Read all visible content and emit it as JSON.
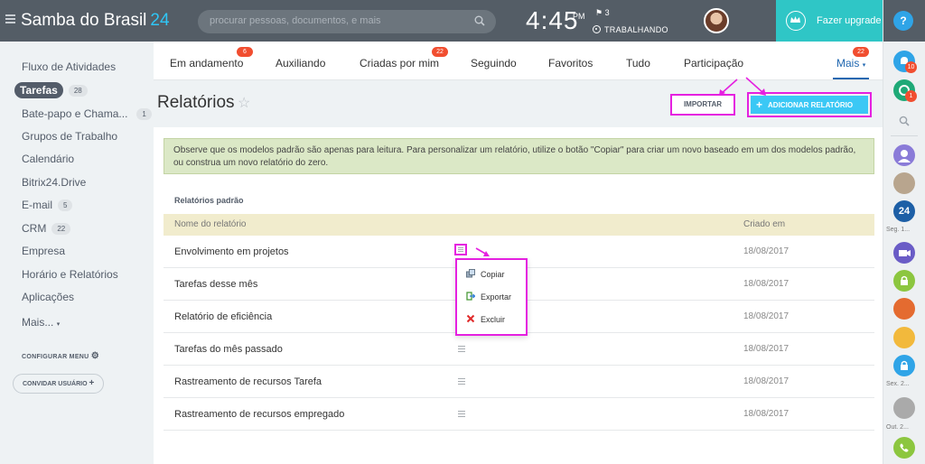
{
  "brand": {
    "name": "Samba do Brasil",
    "suffix": "24"
  },
  "search": {
    "placeholder": "procurar pessoas, documentos, e mais"
  },
  "clock": {
    "time": "4:45",
    "ampm": "PM",
    "flags": "3",
    "status": "TRABALHANDO"
  },
  "upgrade": {
    "label": "Fazer upgrade"
  },
  "rail": {
    "help": "?",
    "badges": [
      "10",
      "1"
    ],
    "labels": [
      "Seg. 1...",
      "Sex. 2...",
      "Out. 2..."
    ],
    "b24": "24"
  },
  "sidebar": {
    "items": [
      {
        "label": "Fluxo de Atividades"
      },
      {
        "label": "Tarefas",
        "count": "28"
      },
      {
        "label": "Bate-papo e Chama...",
        "count": "1"
      },
      {
        "label": "Grupos de Trabalho"
      },
      {
        "label": "Calendário"
      },
      {
        "label": "Bitrix24.Drive"
      },
      {
        "label": "E-mail",
        "count": "5"
      },
      {
        "label": "CRM",
        "count": "22"
      },
      {
        "label": "Empresa"
      },
      {
        "label": "Horário e Relatórios"
      },
      {
        "label": "Aplicações"
      },
      {
        "label": "Mais..."
      }
    ],
    "configure": "CONFIGURAR MENU",
    "invite": "CONVIDAR USUÁRIO"
  },
  "tabs": [
    {
      "label": "Em andamento",
      "badge": "6"
    },
    {
      "label": "Auxiliando"
    },
    {
      "label": "Criadas por mim",
      "badge": "22"
    },
    {
      "label": "Seguindo"
    },
    {
      "label": "Favoritos"
    },
    {
      "label": "Tudo"
    },
    {
      "label": "Participação"
    },
    {
      "label": "Mais",
      "badge": "22"
    }
  ],
  "page": {
    "title": "Relatórios",
    "import_label": "IMPORTAR",
    "add_label": "ADICIONAR RELATÓRIO",
    "notice": "Observe que os modelos padrão são apenas para leitura. Para personalizar um relatório, utilize o botão \"Copiar\" para criar um novo baseado em um dos modelos padrão, ou construa um novo relatório do zero.",
    "section": "Relatórios padrão"
  },
  "table": {
    "col_name": "Nome do relatório",
    "col_created": "Criado em",
    "rows": [
      {
        "name": "Envolvimento em projetos",
        "date": "18/08/2017"
      },
      {
        "name": "Tarefas desse mês",
        "date": "18/08/2017"
      },
      {
        "name": "Relatório de eficiência",
        "date": "18/08/2017"
      },
      {
        "name": "Tarefas do mês passado",
        "date": "18/08/2017"
      },
      {
        "name": "Rastreamento de recursos Tarefa",
        "date": "18/08/2017"
      },
      {
        "name": "Rastreamento de recursos empregado",
        "date": "18/08/2017"
      }
    ]
  },
  "popup": {
    "copy": "Copiar",
    "export": "Exportar",
    "delete": "Excluir"
  },
  "colors": {
    "accent": "#2067b0",
    "highlight": "#e520e0",
    "add_button": "#3bc8f5",
    "badge": "#f14e30"
  }
}
